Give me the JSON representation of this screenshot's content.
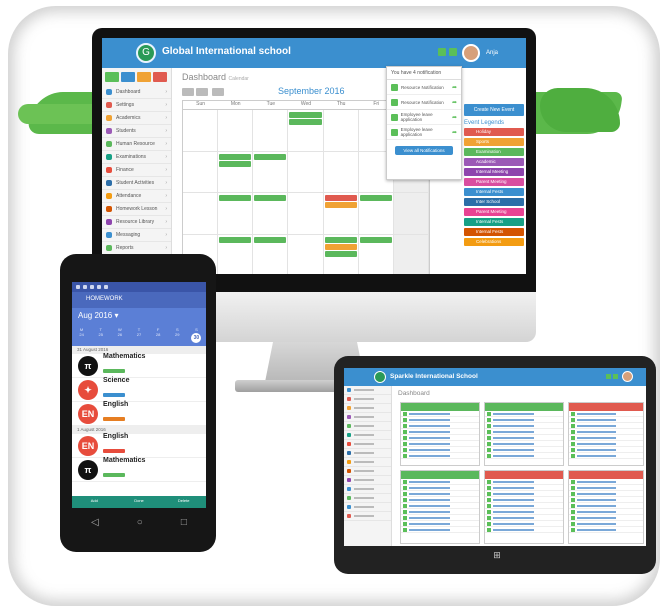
{
  "desktop": {
    "school_name": "Global International school",
    "logo_letter": "G",
    "user": "Anja",
    "page_title": "Dashboard",
    "page_subtitle": "Calendar",
    "calendar_title": "September 2016",
    "weekdays": [
      "Sun",
      "Mon",
      "Tue",
      "Wed",
      "Thu",
      "Fri",
      "Sat"
    ],
    "sidebar_items": [
      "Dashboard",
      "Settings",
      "Academics",
      "Students",
      "Human Resource",
      "Examinations",
      "Finance",
      "Student Activities",
      "Attendance",
      "Homework Lesson",
      "Resource Library",
      "Messaging",
      "Reports"
    ],
    "notifications": {
      "title": "You have 4 notification",
      "items": [
        "Resource Notification",
        "Resource Notification",
        "Employee leave application",
        "Employee leave application"
      ],
      "view_all": "View all Notifications"
    },
    "new_event_button": "Create New Event",
    "legend_title": "Event Legends",
    "legend": [
      {
        "label": "Holiday",
        "color": "#e05a4f"
      },
      {
        "label": "Sports",
        "color": "#f0a234"
      },
      {
        "label": "Examination",
        "color": "#5bb85c"
      },
      {
        "label": "Academic",
        "color": "#9b59b6"
      },
      {
        "label": "Internal Meeting",
        "color": "#8e44ad"
      },
      {
        "label": "Parent Meeting",
        "color": "#d94ea0"
      },
      {
        "label": "Internal Fests",
        "color": "#3b8fcf"
      },
      {
        "label": "Inter School",
        "color": "#2c6ea8"
      },
      {
        "label": "Parent Meeting",
        "color": "#e84393"
      },
      {
        "label": "Internal Fests",
        "color": "#16a085"
      },
      {
        "label": "Internal Fests",
        "color": "#d35400"
      },
      {
        "label": "Celebrations",
        "color": "#f39c12"
      }
    ]
  },
  "tablet": {
    "school_name": "Sparkle International School",
    "page_title": "Dashboard"
  },
  "phone": {
    "app_title": "HOMEWORK",
    "month": "Aug 2016",
    "weekdays": [
      "M",
      "T",
      "W",
      "T",
      "F",
      "S",
      "S"
    ],
    "days": [
      "24",
      "25",
      "26",
      "27",
      "28",
      "29",
      "30"
    ],
    "selected_day": "30",
    "groups": [
      {
        "date": "31 August 2016",
        "items": [
          {
            "subject": "Mathematics",
            "icon": "π",
            "color": "#111111",
            "tag_color": "#5bb85c"
          },
          {
            "subject": "Science",
            "icon": "✦",
            "color": "#e74c3c",
            "tag_color": "#3b8fcf"
          },
          {
            "subject": "English",
            "icon": "EN",
            "color": "#e74c3c",
            "tag_color": "#e67e22"
          }
        ]
      },
      {
        "date": "1 August 2016",
        "items": [
          {
            "subject": "English",
            "icon": "EN",
            "color": "#e74c3c",
            "tag_color": "#e74c3c"
          },
          {
            "subject": "Mathematics",
            "icon": "π",
            "color": "#111111",
            "tag_color": "#5bb85c"
          }
        ]
      }
    ],
    "bottom_tabs": [
      "Add",
      "Done",
      "Delete"
    ]
  }
}
